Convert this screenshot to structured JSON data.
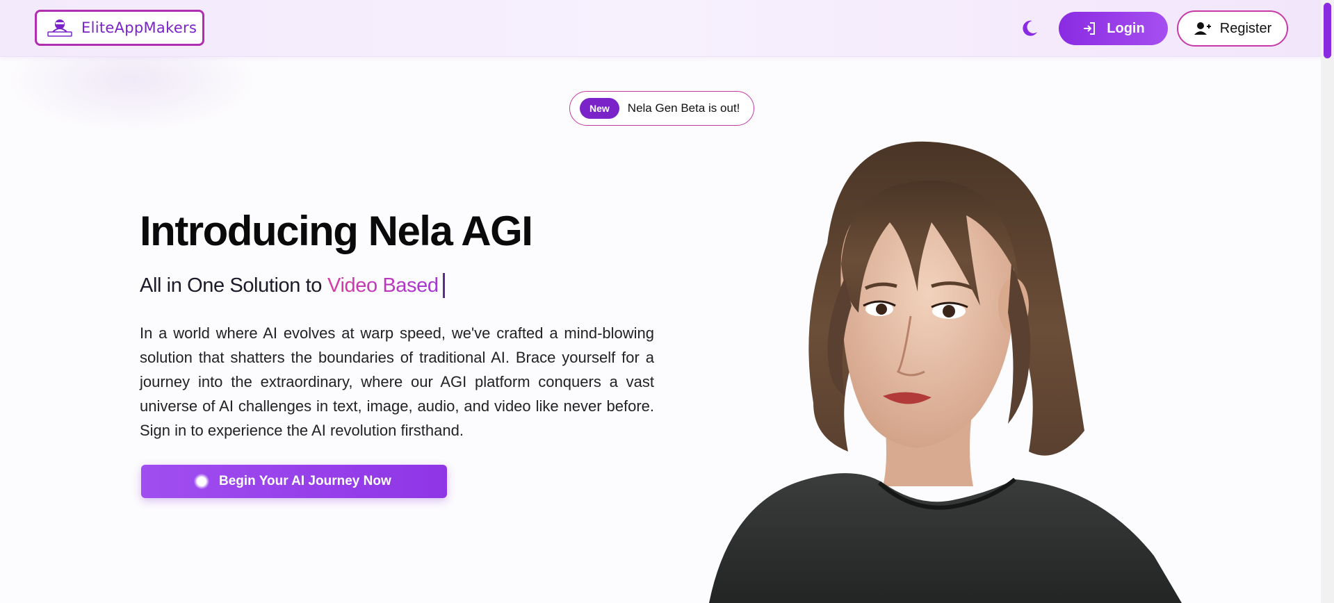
{
  "header": {
    "brand": "EliteAppMakers",
    "login_label": "Login",
    "register_label": "Register",
    "theme_toggle_icon": "moon-icon"
  },
  "announcement": {
    "badge": "New",
    "text": "Nela Gen Beta is out!"
  },
  "hero": {
    "title": "Introducing Nela AGI",
    "subtitle_prefix": "All in One Solution to",
    "subtitle_accent": "Video Based",
    "description": "In a world where AI evolves at warp speed, we've crafted a mind-blowing solution that shatters the boundaries of traditional AI. Brace yourself for a journey into the extraordinary, where our AGI platform conquers a vast universe of AI challenges in text, image, audio, and video like never before. Sign in to experience the AI revolution firsthand.",
    "cta_label": "Begin Your AI Journey Now"
  },
  "colors": {
    "primary": "#8a2be2",
    "accent_pink": "#c83aa8",
    "text": "#111111"
  }
}
